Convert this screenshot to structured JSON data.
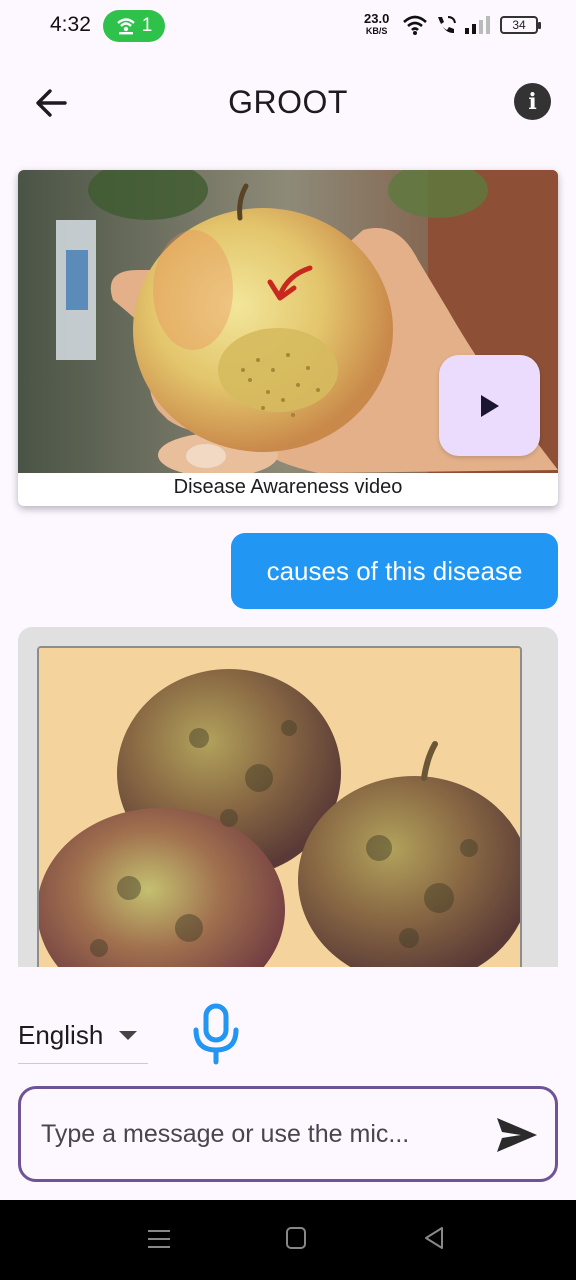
{
  "status_bar": {
    "time": "4:32",
    "hotspot_count": "1",
    "net_speed": "23.0",
    "net_speed_unit": "KB/S",
    "battery_level": "34"
  },
  "app_bar": {
    "title": "GROOT",
    "back_icon": "arrow-back-icon",
    "info_icon": "info-icon"
  },
  "chat": {
    "video_message": {
      "caption": "Disease Awareness video",
      "play_icon": "play-icon"
    },
    "user_message": {
      "text": "causes of this disease"
    },
    "bot_message": {
      "image_description_icon": "diseased-apples-image"
    }
  },
  "composer": {
    "language": "English",
    "mic_icon": "mic-icon",
    "input_placeholder": "Type a message or use the mic...",
    "input_value": "",
    "send_icon": "send-icon"
  },
  "colors": {
    "accent_blue": "#2196f3",
    "border_purple": "#6e5496",
    "play_button_bg": "#ebdcfd",
    "background": "#fdf7ff",
    "hotspot_green": "#2ec24b"
  }
}
